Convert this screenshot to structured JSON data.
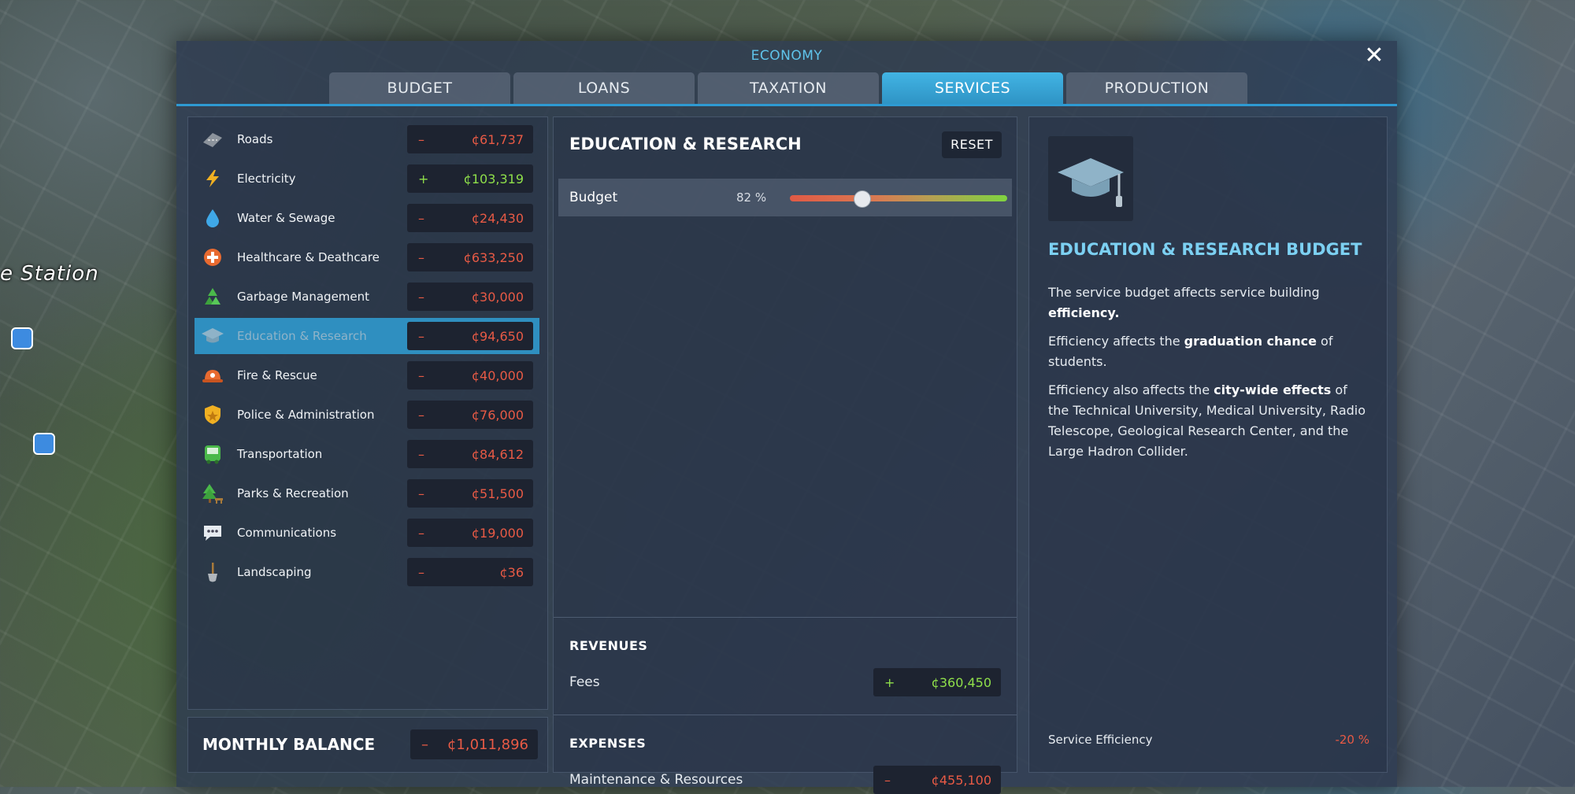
{
  "map": {
    "station_label": "e Station"
  },
  "window": {
    "title": "ECONOMY"
  },
  "tabs": [
    {
      "label": "BUDGET"
    },
    {
      "label": "LOANS"
    },
    {
      "label": "TAXATION"
    },
    {
      "label": "SERVICES"
    },
    {
      "label": "PRODUCTION"
    }
  ],
  "services": [
    {
      "label": "Roads",
      "sign": "–",
      "value": "¢61,737",
      "icon": "roads-icon"
    },
    {
      "label": "Electricity",
      "sign": "+",
      "value": "¢103,319",
      "icon": "lightning-icon"
    },
    {
      "label": "Water & Sewage",
      "sign": "–",
      "value": "¢24,430",
      "icon": "water-drop-icon"
    },
    {
      "label": "Healthcare & Deathcare",
      "sign": "–",
      "value": "¢633,250",
      "icon": "healthcare-icon"
    },
    {
      "label": "Garbage Management",
      "sign": "–",
      "value": "¢30,000",
      "icon": "recycle-icon"
    },
    {
      "label": "Education & Research",
      "sign": "–",
      "value": "¢94,650",
      "icon": "graduation-cap-icon"
    },
    {
      "label": "Fire & Rescue",
      "sign": "–",
      "value": "¢40,000",
      "icon": "fire-helmet-icon"
    },
    {
      "label": "Police & Administration",
      "sign": "–",
      "value": "¢76,000",
      "icon": "police-badge-icon"
    },
    {
      "label": "Transportation",
      "sign": "–",
      "value": "¢84,612",
      "icon": "bus-icon"
    },
    {
      "label": "Parks & Recreation",
      "sign": "–",
      "value": "¢51,500",
      "icon": "tree-icon"
    },
    {
      "label": "Communications",
      "sign": "–",
      "value": "¢19,000",
      "icon": "chat-bubble-icon"
    },
    {
      "label": "Landscaping",
      "sign": "–",
      "value": "¢36",
      "icon": "shovel-icon"
    }
  ],
  "balance": {
    "label": "MONTHLY BALANCE",
    "sign": "–",
    "value": "¢1,011,896"
  },
  "detail": {
    "title": "EDUCATION & RESEARCH",
    "reset_label": "RESET",
    "budget_label": "Budget",
    "budget_pct_text": "82 %",
    "budget_level": 0.33,
    "revenues_head": "REVENUES",
    "fees_label": "Fees",
    "fees_sign": "+",
    "fees_value": "¢360,450",
    "expenses_head": "EXPENSES",
    "maint_label": "Maintenance & Resources",
    "maint_sign": "–",
    "maint_value": "¢455,100"
  },
  "info": {
    "title": "EDUCATION & RESEARCH BUDGET",
    "p1_a": "The service budget affects service building ",
    "p1_b": "efficiency.",
    "p2_a": "Efficiency affects the ",
    "p2_b": "graduation chance",
    "p2_c": " of students.",
    "p3_a": "Efficiency also affects the ",
    "p3_b": "city-wide effects",
    "p3_c": " of the Technical University, Medical University, Radio Telescope, Geological Research Center, and the Large Hadron Collider.",
    "efficiency_label": "Service Efficiency",
    "efficiency_value": "-20 %"
  },
  "colors": {
    "accent": "#2e93c4",
    "negative": "#e85a45",
    "positive": "#8fe04a",
    "title_blue": "#7cd0f2"
  }
}
